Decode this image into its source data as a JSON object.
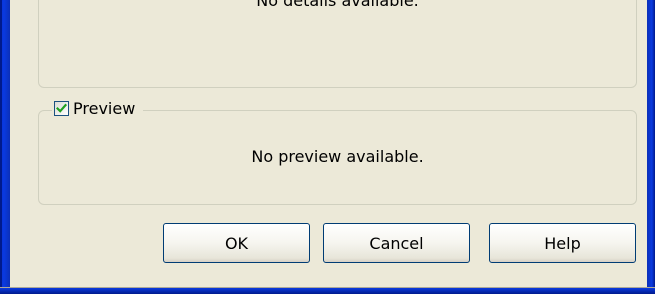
{
  "details": {
    "text": "No details available."
  },
  "preview": {
    "checkbox_label": "Preview",
    "checked": true,
    "text": "No preview available."
  },
  "buttons": {
    "ok_label": "OK",
    "cancel_label": "Cancel",
    "help_label": "Help"
  },
  "colors": {
    "dialog_background": "#ece9d8",
    "window_frame": "#0a3ae0",
    "groupbox_border": "#d0d0bf",
    "button_border": "#003c74",
    "checkmark": "#21a121"
  }
}
